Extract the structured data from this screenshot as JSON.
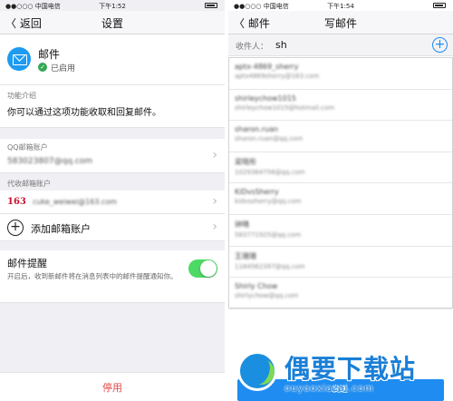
{
  "left": {
    "status": {
      "carrier": "●●○○○ 中国电信",
      "time": "下午1:52"
    },
    "nav": {
      "back": "〈 返回",
      "title": "设置"
    },
    "mail_card": {
      "name": "邮件",
      "check": "✓",
      "status": "已启用"
    },
    "intro": {
      "label": "功能介绍",
      "text": "你可以通过这项功能收取和回复邮件。"
    },
    "qq_account": {
      "label": "QQ邮箱账户",
      "value": "583023807@qq.com"
    },
    "proxy": {
      "label": "代收邮箱账户",
      "logo": "163",
      "email": "cuke_weiwei@163.com",
      "add_label": "添加邮箱账户"
    },
    "reminder": {
      "title": "邮件提醒",
      "description": "开启后，收到新邮件将在消息列表中的邮件提醒通知你。",
      "enabled": true
    },
    "disable_label": "停用",
    "chevron": "›",
    "plus": "+"
  },
  "right": {
    "status": {
      "carrier": "●●○○○ 中国电信",
      "time": "下午1:54"
    },
    "nav": {
      "back": "〈 邮件",
      "title": "写邮件"
    },
    "recipient": {
      "label": "收件人：",
      "value": "sh",
      "plus": "+"
    },
    "suggestions": [
      {
        "name": "aptx-4869_sherry",
        "email": "aptx4869sherry@163.com"
      },
      {
        "name": "shirleychow1015",
        "email": "shirleychow1015@hotmail.com"
      },
      {
        "name": "sharon.ruan",
        "email": "sharon.ruan@qq.com"
      },
      {
        "name": "梁晓彤",
        "email": "1029384756@qq.com"
      },
      {
        "name": "KiDvsSherry",
        "email": "kidvssherry@qq.com"
      },
      {
        "name": "钟晴",
        "email": "583771925@qq.com"
      },
      {
        "name": "王珊珊",
        "email": "1184562397@qq.com"
      },
      {
        "name": "Shirly Chow",
        "email": "shirlychow@qq.com"
      }
    ],
    "send_label": "发送"
  },
  "watermark": {
    "title": "偶要下载站",
    "url": "ouyaoxiazai.com"
  },
  "colors": {
    "accent": "#1e8cf0",
    "toggle_on": "#4cd964",
    "danger": "#e34a4a",
    "brand_163": "#c8102e"
  }
}
